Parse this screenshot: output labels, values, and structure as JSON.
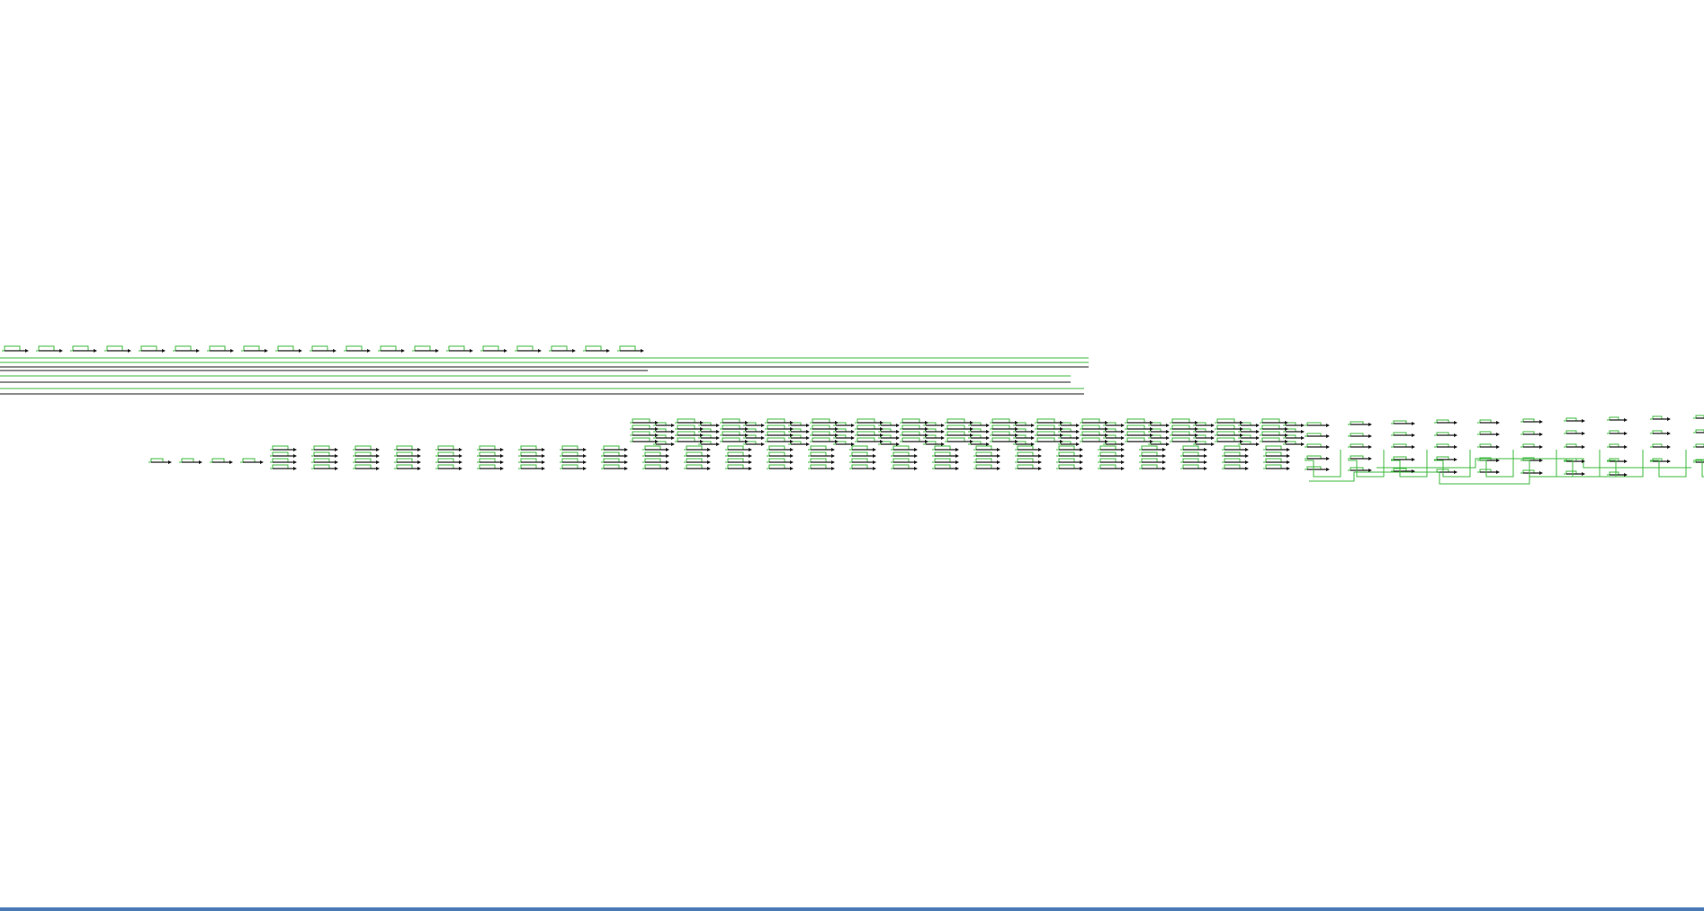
{
  "diagram": {
    "kind": "logic-circuit",
    "wire_color": "#3db83d",
    "node_color": "#1a1a1a",
    "background_color": "#ffffff",
    "border_color": "#4a7ab5"
  }
}
